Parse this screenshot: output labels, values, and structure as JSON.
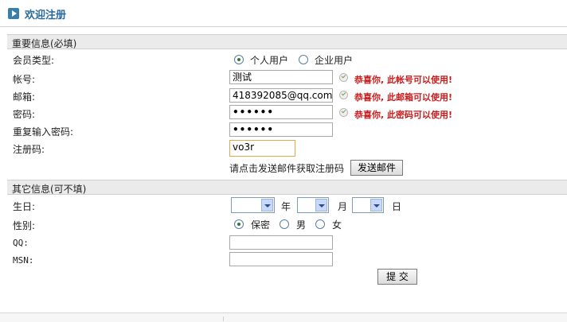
{
  "header": {
    "title": "欢迎注册",
    "icon": "play-icon"
  },
  "sections": {
    "required": "重要信息(必填)",
    "optional": "其它信息(可不填)"
  },
  "labels": {
    "member_type": "会员类型:",
    "account": "帐号:",
    "email": "邮箱:",
    "password": "密码:",
    "password_confirm": "重复输入密码:",
    "reg_code": "注册码:",
    "birthday": "生日:",
    "gender": "性别:",
    "qq": "QQ:",
    "msn": "MSN:"
  },
  "member_type": {
    "options": [
      "个人用户",
      "企业用户"
    ],
    "selected": "个人用户"
  },
  "fields": {
    "account": "测试",
    "email": "418392085@qq.com",
    "password": "••••••",
    "password_confirm": "••••••",
    "reg_code": "vo3r",
    "qq": "",
    "msn": ""
  },
  "messages": {
    "account_ok": "恭喜你, 此帐号可以使用!",
    "email_ok": "恭喜你, 此邮箱可以使用!",
    "password_ok": "恭喜你, 此密码可以使用!"
  },
  "reg_code_hint": "请点击发送邮件获取注册码",
  "send_email_button": "发送邮件",
  "birthday": {
    "year_unit": "年",
    "month_unit": "月",
    "day_unit": "日",
    "year": "",
    "month": "",
    "day": ""
  },
  "gender": {
    "options": [
      "保密",
      "男",
      "女"
    ],
    "selected": "保密"
  },
  "submit_button": "提 交",
  "colors": {
    "accent": "#2a6a9a",
    "success_text": "#cc1a1a",
    "section_bg": "#ebebeb"
  }
}
